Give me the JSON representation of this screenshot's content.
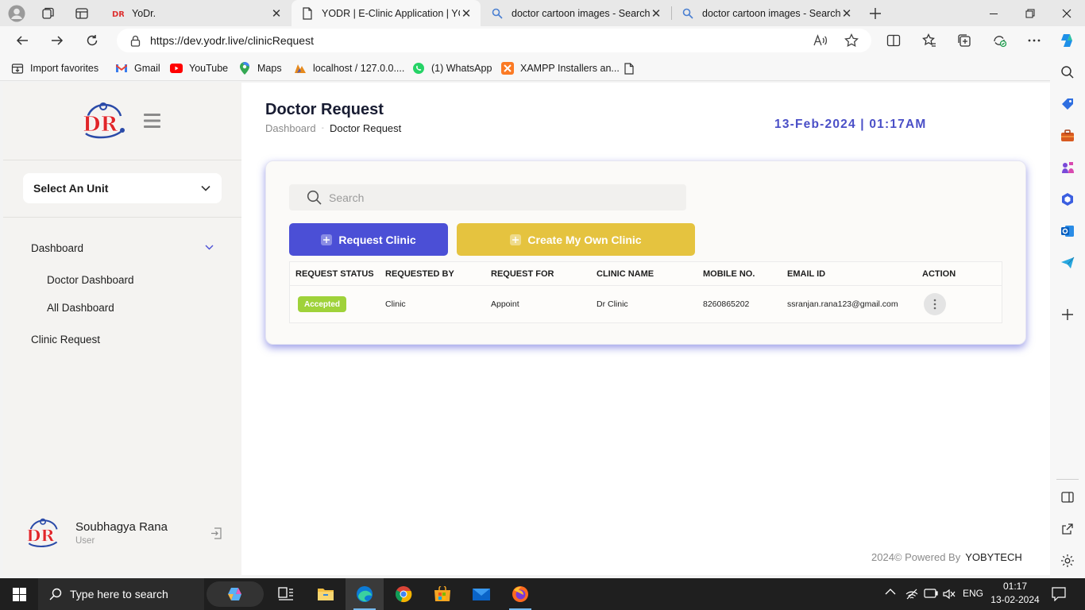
{
  "browser": {
    "tabs": [
      {
        "title": "YoDr.",
        "active": false
      },
      {
        "title": "YODR | E-Clinic Application | YODR",
        "active": true
      },
      {
        "title": "doctor cartoon images - Search",
        "active": false
      },
      {
        "title": "doctor cartoon images - Search I",
        "active": false
      }
    ],
    "url": "https://dev.yodr.live/clinicRequest",
    "favorites": [
      {
        "label": "Import favorites",
        "icon": "import-icon"
      },
      {
        "label": "Gmail",
        "icon": "gmail-icon"
      },
      {
        "label": "YouTube",
        "icon": "youtube-icon"
      },
      {
        "label": "Maps",
        "icon": "maps-icon"
      },
      {
        "label": "localhost / 127.0.0....",
        "icon": "phpmyadmin-icon"
      },
      {
        "label": "(1) WhatsApp",
        "icon": "whatsapp-icon"
      },
      {
        "label": "XAMPP Installers an...",
        "icon": "xampp-icon"
      }
    ]
  },
  "sidebar": {
    "logo_text": "DR",
    "unit_select": "Select An Unit",
    "nav": {
      "dashboard": "Dashboard",
      "doctor_dashboard": "Doctor Dashboard",
      "all_dashboard": "All Dashboard",
      "clinic_request": "Clinic Request"
    },
    "user": {
      "name": "Soubhagya Rana",
      "role": "User"
    }
  },
  "header": {
    "title": "Doctor Request",
    "breadcrumb": [
      "Dashboard",
      "Doctor Request"
    ],
    "datetime": "13-Feb-2024 | 01:17AM"
  },
  "search": {
    "placeholder": "Search"
  },
  "buttons": {
    "request_clinic": "Request Clinic",
    "create_own_clinic": "Create My Own Clinic"
  },
  "table": {
    "columns": [
      "REQUEST STATUS",
      "REQUESTED BY",
      "REQUEST FOR",
      "CLINIC NAME",
      "MOBILE NO.",
      "EMAIL ID",
      "ACTION"
    ],
    "rows": [
      {
        "status": "Accepted",
        "requested_by": "Clinic",
        "request_for": "Appoint",
        "clinic_name": "Dr Clinic",
        "mobile": "8260865202",
        "email": "ssranjan.rana123@gmail.com"
      }
    ]
  },
  "footer": {
    "powered": "2024© Powered By",
    "company": "YOBYTECH"
  },
  "taskbar": {
    "search_placeholder": "Type here to search",
    "language": "ENG",
    "time": "01:17",
    "date": "13-02-2024"
  },
  "colors": {
    "accent_blue": "#4b4fd6",
    "accent_yellow": "#e5c33f",
    "status_green": "#9fd23a",
    "date_color": "#4a4fc7"
  }
}
